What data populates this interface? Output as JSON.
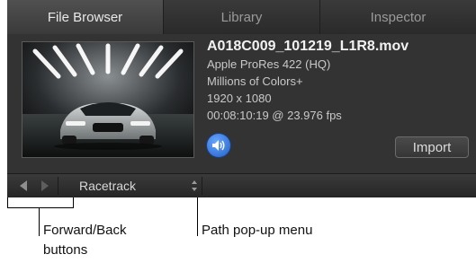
{
  "tabs": [
    {
      "label": "File Browser",
      "active": true
    },
    {
      "label": "Library",
      "active": false
    },
    {
      "label": "Inspector",
      "active": false
    }
  ],
  "clip": {
    "filename": "A018C009_101219_L1R8.mov",
    "codec": "Apple ProRes 422 (HQ)",
    "color": "Millions of Colors+",
    "resolution": "1920 x 1080",
    "duration": "00:08:10:19 @ 23.976 fps"
  },
  "buttons": {
    "import_label": "Import"
  },
  "path": {
    "current": "Racetrack"
  },
  "icons": {
    "speaker": "speaker-icon",
    "back": "back-arrow-icon",
    "forward": "forward-arrow-icon",
    "path_menu": "updown-arrows-icon"
  },
  "callouts": {
    "nav_line1": "Forward/Back",
    "nav_line2": "buttons",
    "path_menu": "Path pop-up menu"
  },
  "colors": {
    "panel_bg": "#333333",
    "tab_active": "#505050",
    "accent_blue": "#2f7be0"
  }
}
